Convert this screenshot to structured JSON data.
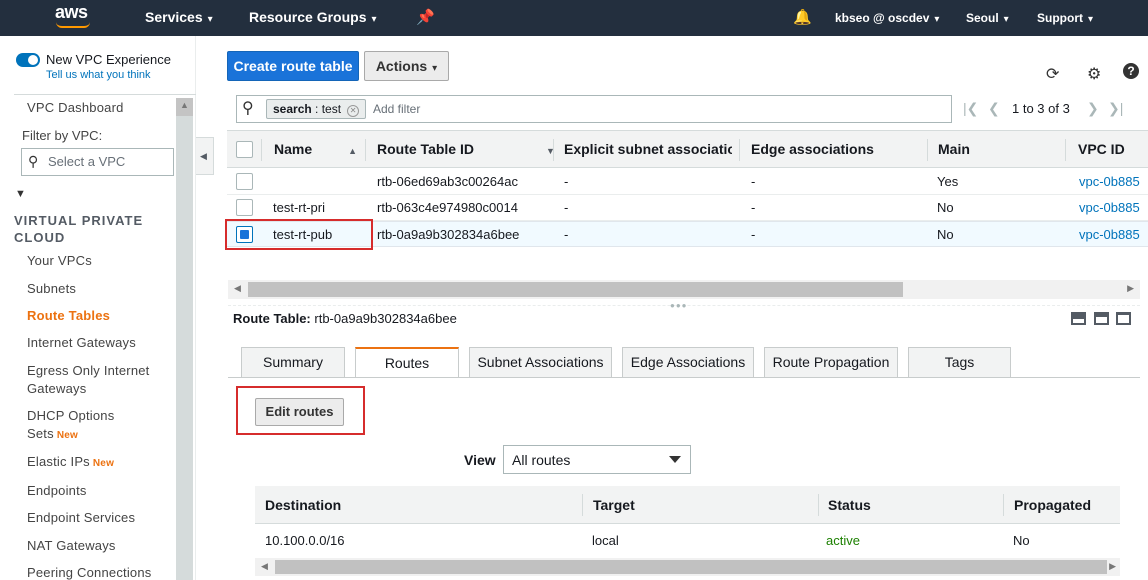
{
  "topbar": {
    "logo": "aws",
    "services": "Services",
    "resource_groups": "Resource Groups",
    "pin_icon": "pin-icon",
    "bell_icon": "bell-icon",
    "account": "kbseo @ oscdev",
    "region": "Seoul",
    "support": "Support",
    "caret": "▾"
  },
  "sidebar": {
    "experience_title": "New VPC Experience",
    "experience_link": "Tell us what you think",
    "dashboard": "VPC Dashboard",
    "filter_label": "Filter by VPC:",
    "vpc_select_placeholder": "Select a VPC",
    "section_arrow": "▼",
    "section_title_1": "VIRTUAL PRIVATE",
    "section_title_2": "CLOUD",
    "items": [
      {
        "label": "Your VPCs"
      },
      {
        "label": "Subnets"
      },
      {
        "label": "Route Tables"
      },
      {
        "label": "Internet Gateways"
      },
      {
        "label": "Egress Only Internet"
      },
      {
        "label": "Gateways"
      },
      {
        "label": "DHCP Options"
      },
      {
        "label": "Sets"
      },
      {
        "label": "Elastic IPs"
      },
      {
        "label": "Endpoints"
      },
      {
        "label": "Endpoint Services"
      },
      {
        "label": "NAT Gateways"
      },
      {
        "label": "Peering Connections"
      }
    ],
    "new_badge": "New"
  },
  "toolbar": {
    "create_label": "Create route table",
    "actions_label": "Actions",
    "refresh_icon": "refresh-icon",
    "settings_icon": "gear-icon",
    "help_icon": "help-icon"
  },
  "search": {
    "token_key": "search",
    "token_sep": " : ",
    "token_value": "test",
    "add_filter_placeholder": "Add filter",
    "pager_text": "1 to 3 of 3"
  },
  "route_tables": {
    "columns": [
      "Name",
      "Route Table ID",
      "Explicit subnet association",
      "Edge associations",
      "Main",
      "VPC ID"
    ],
    "rows": [
      {
        "name": "",
        "id": "rtb-06ed69ab3c00264ac",
        "explicit": "-",
        "edge": "-",
        "main": "Yes",
        "vpc": "vpc-0b885",
        "selected": false
      },
      {
        "name": "test-rt-pri",
        "id": "rtb-063c4e974980c0014",
        "explicit": "-",
        "edge": "-",
        "main": "No",
        "vpc": "vpc-0b885",
        "selected": false
      },
      {
        "name": "test-rt-pub",
        "id": "rtb-0a9a9b302834a6bee",
        "explicit": "-",
        "edge": "-",
        "main": "No",
        "vpc": "vpc-0b885",
        "selected": true
      }
    ]
  },
  "detail": {
    "label": "Route Table:",
    "value": "rtb-0a9a9b302834a6bee",
    "tabs": [
      {
        "label": "Summary"
      },
      {
        "label": "Routes"
      },
      {
        "label": "Subnet Associations"
      },
      {
        "label": "Edge Associations"
      },
      {
        "label": "Route Propagation"
      },
      {
        "label": "Tags"
      }
    ],
    "active_tab": "Routes",
    "edit_routes_label": "Edit routes",
    "view_label": "View",
    "view_value": "All routes"
  },
  "routes": {
    "columns": [
      "Destination",
      "Target",
      "Status",
      "Propagated"
    ],
    "rows": [
      {
        "destination": "10.100.0.0/16",
        "target": "local",
        "status": "active",
        "propagated": "No"
      }
    ]
  },
  "colors": {
    "topbar_bg": "#232f3e",
    "primary_button": "#1a73d9",
    "active_nav": "#ec7211",
    "link": "#0073bb",
    "status_active": "#1d8102",
    "highlight_box": "#d62c2c"
  }
}
